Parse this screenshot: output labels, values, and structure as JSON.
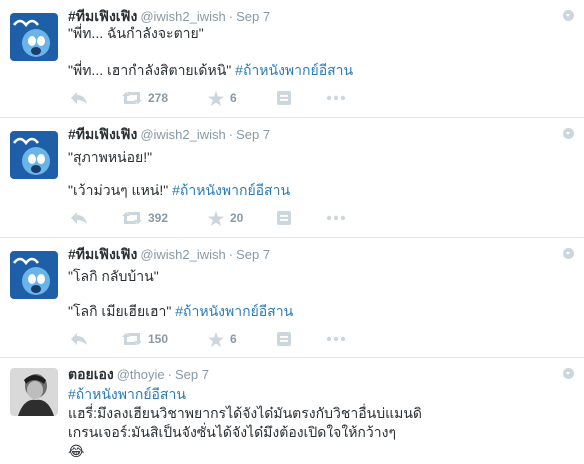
{
  "tweets": [
    {
      "name": "#ทีมเฟิงเฟิง",
      "handle": "@iwish2_iwish",
      "time": "Sep 7",
      "line1": "\"พี่ท... ฉันกำลังจะตาย\"",
      "line2_text": "\"พี่ท... เฮากำลังสิตายเด้หนิ\" ",
      "hashtag": "#ถ้าหนังพากย์อีสาน",
      "retweets": "278",
      "favorites": "6"
    },
    {
      "name": "#ทีมเฟิงเฟิง",
      "handle": "@iwish2_iwish",
      "time": "Sep 7",
      "line1": "\"สุภาพหน่อย!\"",
      "line2_text": "\"เว้าม่วนๆ แหน่!\" ",
      "hashtag": "#ถ้าหนังพากย์อีสาน",
      "retweets": "392",
      "favorites": "20"
    },
    {
      "name": "#ทีมเฟิงเฟิง",
      "handle": "@iwish2_iwish",
      "time": "Sep 7",
      "line1": "\"โลกิ กลับบ้าน\"",
      "line2_text": "\"โลกิ เมียเฮียเฮา\" ",
      "hashtag": "#ถ้าหนังพากย์อีสาน",
      "retweets": "150",
      "favorites": "6"
    },
    {
      "name": "ตอยเอง",
      "handle": "@thoyie",
      "time": "Sep 7",
      "hashtag": "#ถ้าหนังพากย์อีสาน",
      "line_a": "แฮรี่:มึงลงเฮียนวิชาพยากรได้จังได๋มันตรงกับวิชาอื่นบ่แมนดิ",
      "line_b": "เกรนเจอร์:มันสิเป็นจังซั่นได้จังได๋มึงต้องเปิดใจให้กว้างๆ",
      "emoji": "😂"
    }
  ],
  "colors": {
    "link": "#2b7bb9",
    "meta": "#8899a6",
    "icon": "#ccd6dd",
    "text": "#292f33"
  }
}
